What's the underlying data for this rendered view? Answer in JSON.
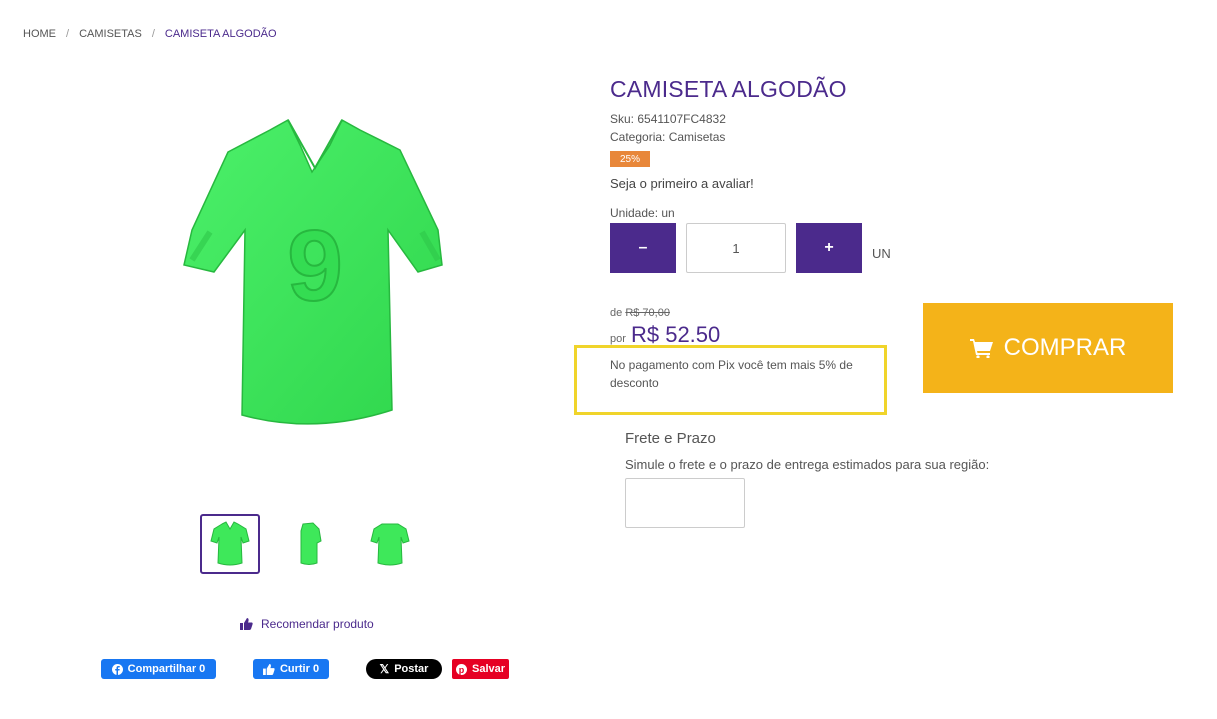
{
  "breadcrumb": {
    "home": "HOME",
    "category": "CAMISETAS",
    "current": "CAMISETA ALGODÃO",
    "separator": "/"
  },
  "product": {
    "title": "CAMISETA ALGODÃO",
    "sku": "Sku: 6541107FC4832",
    "category": "Categoria: Camisetas",
    "discount_badge": "25%",
    "rating_text": "Seja o primeiro a avaliar!",
    "unit_label": "Unidade: un",
    "quantity": "1",
    "unit_suffix": "UN",
    "minus_label": "–",
    "plus_label": "+",
    "price": {
      "old_prefix": "de",
      "old_value": "R$ 70,00",
      "new_prefix": "por",
      "new_value": "R$ 52.50"
    },
    "pix_note": "No pagamento com Pix você tem mais 5% de desconto",
    "buy_label": "COMPRAR"
  },
  "shipping": {
    "title": "Frete e Prazo",
    "description": "Simule o frete e o prazo de entrega estimados para sua região:",
    "cep_value": ""
  },
  "recommend_label": "Recomendar produto",
  "social": {
    "fb_share": "Compartilhar 0",
    "fb_like": "Curtir 0",
    "x_post": "Postar",
    "pinterest": "Salvar"
  },
  "colors": {
    "brand_purple": "#4b2a8c",
    "buy_yellow": "#f4b319",
    "badge_orange": "#e8873a",
    "highlight_yellow": "#f0d42a",
    "shirt_green": "#3ee85a"
  },
  "icons": {
    "cart": "cart-icon",
    "thumbs_up": "thumbs-up-icon",
    "facebook": "facebook-icon",
    "x": "x-logo-icon",
    "pinterest": "pinterest-icon"
  }
}
